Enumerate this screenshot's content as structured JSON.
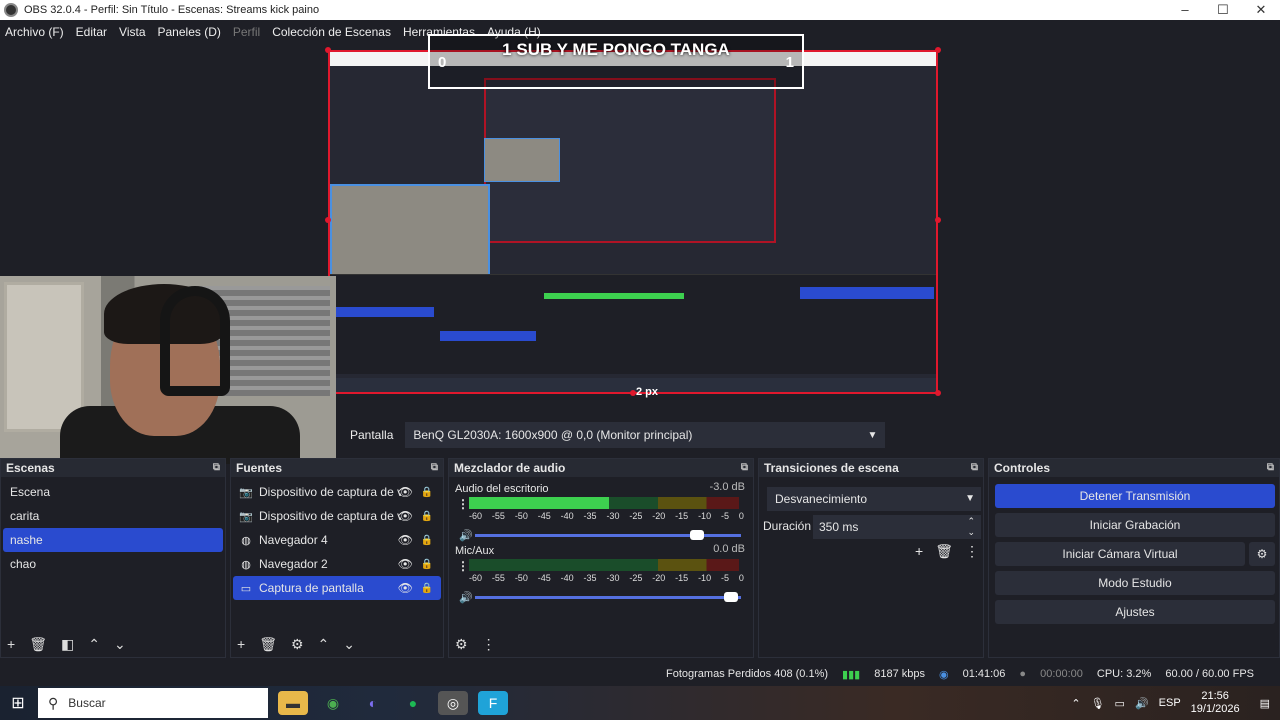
{
  "window": {
    "title": "OBS 32.0.4 - Perfil: Sin Título - Escenas: Streams kick paino"
  },
  "menu": {
    "items": [
      "Archivo (F)",
      "Editar",
      "Vista",
      "Paneles (D)",
      "Perfil",
      "Colección de Escenas",
      "Herramientas",
      "Ayuda (H)"
    ]
  },
  "preview": {
    "banner_text": "1 SUB Y ME PONGO TANGA",
    "banner_left": "0",
    "banner_right": "1",
    "px_label": "2 px"
  },
  "source_bar": {
    "label": "Pantalla",
    "value": "BenQ GL2030A: 1600x900 @ 0,0 (Monitor principal)"
  },
  "scenes": {
    "title": "Escenas",
    "items": [
      "Escena",
      "carita",
      "nashe",
      "chao"
    ],
    "selected": "nashe"
  },
  "sources": {
    "title": "Fuentes",
    "items": [
      {
        "name": "Dispositivo de captura de vide",
        "icon": "camera-icon"
      },
      {
        "name": "Dispositivo de captura de vide",
        "icon": "camera-icon"
      },
      {
        "name": "Navegador 4",
        "icon": "globe-icon"
      },
      {
        "name": "Navegador 2",
        "icon": "globe-icon"
      },
      {
        "name": "Captura de pantalla",
        "icon": "monitor-icon"
      }
    ],
    "selected": "Captura de pantalla"
  },
  "mixer": {
    "title": "Mezclador de audio",
    "channels": [
      {
        "name": "Audio del escritorio",
        "db": "-3.0 dB",
        "level": 0.52,
        "volume": 0.86
      },
      {
        "name": "Mic/Aux",
        "db": "0.0 dB",
        "level": 0.0,
        "volume": 0.99
      }
    ],
    "ticks": [
      "-60",
      "-55",
      "-50",
      "-45",
      "-40",
      "-35",
      "-30",
      "-25",
      "-20",
      "-15",
      "-10",
      "-5",
      "0"
    ]
  },
  "transitions": {
    "title": "Transiciones de escena",
    "selected": "Desvanecimiento",
    "duration_label": "Duración",
    "duration": "350 ms"
  },
  "controls": {
    "title": "Controles",
    "buttons": [
      "Detener Transmisión",
      "Iniciar Grabación",
      "Iniciar Cámara Virtual",
      "Modo Estudio",
      "Ajustes"
    ]
  },
  "status": {
    "dropped": "Fotogramas Perdidos 408 (0.1%)",
    "bitrate": "8187 kbps",
    "stream_time": "01:41:06",
    "rec_time": "00:00:00",
    "cpu": "CPU: 3.2%",
    "fps": "60.00 / 60.00 FPS"
  },
  "taskbar": {
    "search_placeholder": "Buscar",
    "lang": "ESP",
    "time": "21:56",
    "date": "19/1/2026"
  },
  "colors": {
    "accent": "#2a4bcf",
    "selection_border": "#e0182d",
    "meter_green": "#3dd04f"
  }
}
